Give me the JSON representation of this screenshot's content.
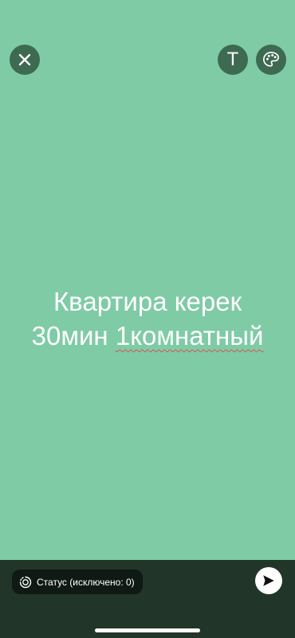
{
  "editor": {
    "background_color": "#7fcba6",
    "button_color": "#3e6a52",
    "text_line_1": "Квартира керек",
    "text_line_2_part_1": "30мин ",
    "text_line_2_part_2": "1комнатный",
    "text_tool_label": "T",
    "close_icon": "close-icon",
    "palette_icon": "palette-icon"
  },
  "bottom_bar": {
    "background_color": "#223529",
    "privacy_label": "Статус (исключено: 0)",
    "privacy_icon": "status-ring-icon",
    "send_icon": "send-arrow-icon"
  }
}
